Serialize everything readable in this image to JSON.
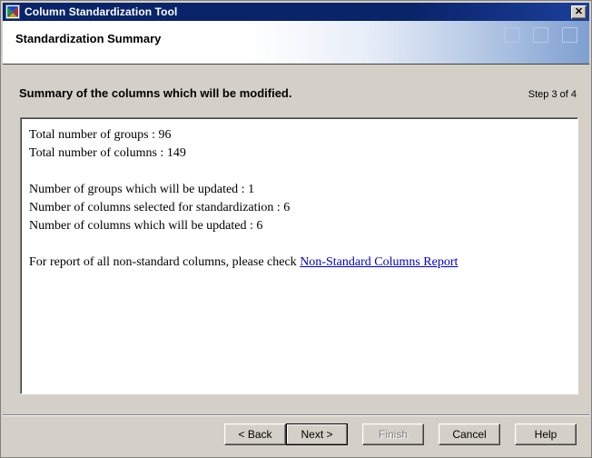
{
  "window": {
    "title": "Column Standardization Tool",
    "icon": "column-standardization-icon",
    "close_label": "✕"
  },
  "header": {
    "title": "Standardization Summary",
    "decoration_squares": 3
  },
  "main": {
    "subheading": "Summary of the columns which will be modified.",
    "step_label": "Step 3 of 4",
    "summary": {
      "lines": [
        "Total number of groups : 96",
        "Total number of columns : 149",
        "",
        "Number of groups which will be updated : 1",
        "Number of columns selected for standardization : 6",
        "Number of columns which will be updated : 6",
        ""
      ],
      "report_prefix": "For report of all non-standard columns, please check ",
      "report_link": "Non-Standard Columns Report"
    }
  },
  "footer": {
    "buttons": [
      {
        "label": "< Back",
        "state": "enabled"
      },
      {
        "label": "Next >",
        "state": "default"
      },
      {
        "label": "Finish",
        "state": "disabled"
      },
      {
        "label": "Cancel",
        "state": "enabled"
      },
      {
        "label": "Help",
        "state": "enabled"
      }
    ]
  },
  "colors": {
    "titlebar": "#0a246a",
    "face": "#d4d0c8",
    "link": "#0000cc",
    "panel": "#ffffff",
    "disabled_text": "#808080"
  }
}
